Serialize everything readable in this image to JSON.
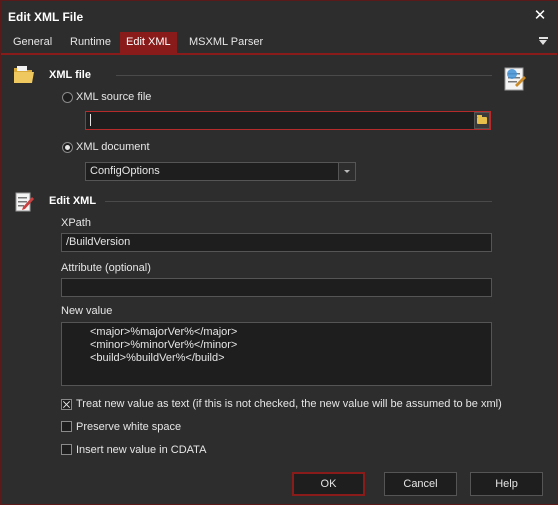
{
  "window": {
    "title": "Edit XML File"
  },
  "tabs": [
    "General",
    "Runtime",
    "Edit XML",
    "MSXML Parser"
  ],
  "xml_file_section": {
    "title": "XML file",
    "source_file_label": "XML source file",
    "source_file_value": "",
    "document_label": "XML document",
    "document_selected": "ConfigOptions",
    "selected_option": "document"
  },
  "edit_xml_section": {
    "title": "Edit XML",
    "xpath_label": "XPath",
    "xpath_value": "/BuildVersion",
    "attribute_label": "Attribute (optional)",
    "attribute_value": "",
    "new_value_label": "New value",
    "new_value_lines": [
      "<major>%majorVer%</major>",
      "<minor>%minorVer%</minor>",
      "<build>%buildVer%</build>"
    ]
  },
  "options": {
    "treat_as_text_label": "Treat new value as text (if this is not checked, the new value will be assumed to be xml)",
    "treat_as_text_checked": true,
    "preserve_whitespace_label": "Preserve white space",
    "preserve_whitespace_checked": false,
    "cdata_label": "Insert new value in CDATA",
    "cdata_checked": false
  },
  "buttons": {
    "ok": "OK",
    "cancel": "Cancel",
    "help": "Help"
  },
  "colors": {
    "accent": "#8a1b1b",
    "background": "#2d2d2d",
    "field": "#1e1e1e"
  }
}
